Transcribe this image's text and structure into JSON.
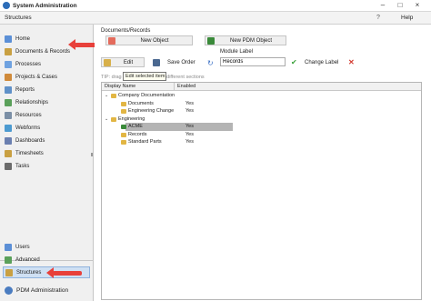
{
  "window": {
    "title": "System Administration"
  },
  "menubar": {
    "structures_label": "Structures",
    "help_label": "Help"
  },
  "sidebar": {
    "items": [
      {
        "label": "Home",
        "icon": "home-icon",
        "color": "#5b8fd6"
      },
      {
        "label": "Documents & Records",
        "icon": "documents-icon",
        "color": "#c9a042"
      },
      {
        "label": "Processes",
        "icon": "processes-icon",
        "color": "#6fa2e0"
      },
      {
        "label": "Projects & Cases",
        "icon": "projects-icon",
        "color": "#d08a3a"
      },
      {
        "label": "Reports",
        "icon": "reports-icon",
        "color": "#5f90c8"
      },
      {
        "label": "Relationships",
        "icon": "relationships-icon",
        "color": "#5aa05a"
      },
      {
        "label": "Resources",
        "icon": "resources-icon",
        "color": "#7b8fa6"
      },
      {
        "label": "Webforms",
        "icon": "webforms-icon",
        "color": "#4c9ad0"
      },
      {
        "label": "Dashboards",
        "icon": "dashboards-icon",
        "color": "#6a7fb0"
      },
      {
        "label": "Timesheets",
        "icon": "timesheets-icon",
        "color": "#c9a042"
      },
      {
        "label": "Tasks",
        "icon": "tasks-icon",
        "color": "#6b6b6b"
      }
    ],
    "bottom_items": [
      {
        "label": "Users",
        "icon": "users-icon",
        "color": "#5b8fd6"
      },
      {
        "label": "Advanced",
        "icon": "advanced-icon",
        "color": "#5aa05a"
      },
      {
        "label": "Structures",
        "icon": "structures-icon",
        "color": "#c9a042",
        "selected": true
      }
    ],
    "footer_title": "PDM Administration"
  },
  "main": {
    "section_title": "Documents/Records",
    "new_object_label": "New Object",
    "new_pdm_object_label": "New PDM Object",
    "edit_label": "Edit",
    "save_order_label": "Save Order",
    "module_label_caption": "Module Label",
    "module_label_value": "Records",
    "change_label_label": "Change Label",
    "tooltip_text": "Edit selected item",
    "tip_text": "TIP: drag and drop objects in different sections",
    "grid": {
      "columns": [
        "Display Name",
        "Enabled"
      ],
      "rows": [
        {
          "name": "Company Documentation",
          "enabled": "",
          "level": 0,
          "type": "folder",
          "expanded": true
        },
        {
          "name": "Documents",
          "enabled": "Yes",
          "level": 1,
          "type": "folder"
        },
        {
          "name": "Engineering Change",
          "enabled": "Yes",
          "level": 1,
          "type": "folder"
        },
        {
          "name": "Engineering",
          "enabled": "",
          "level": 0,
          "type": "folder",
          "expanded": true
        },
        {
          "name": "ACME",
          "enabled": "Yes",
          "level": 1,
          "type": "pdm",
          "selected": true
        },
        {
          "name": "Records",
          "enabled": "Yes",
          "level": 1,
          "type": "folder"
        },
        {
          "name": "Standard Parts",
          "enabled": "Yes",
          "level": 1,
          "type": "folder"
        }
      ]
    }
  },
  "colors": {
    "accent": "#e8403a",
    "selection": "#cfe0f3",
    "folder": "#e2b644",
    "pdm_green": "#3a8a3a"
  }
}
